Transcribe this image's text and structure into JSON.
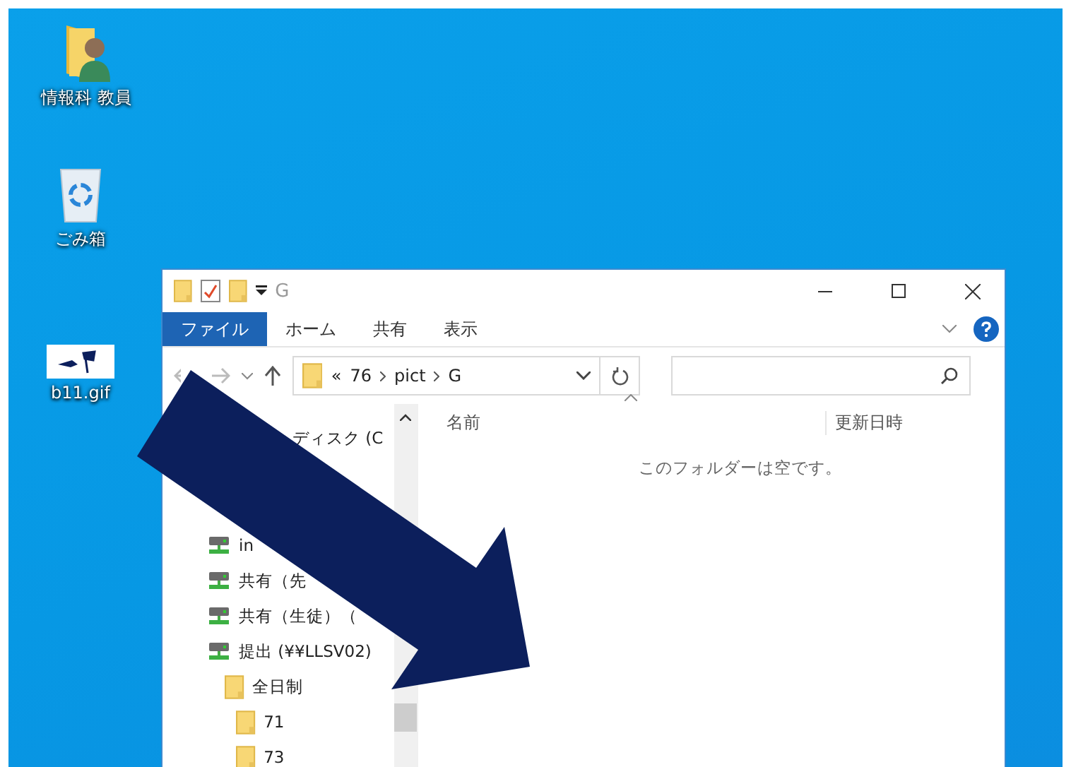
{
  "desktop_icons": [
    {
      "label": "情報科 教員",
      "kind": "user-folder"
    },
    {
      "label": "ごみ箱",
      "kind": "recycle-bin"
    },
    {
      "label": "b11.gif",
      "kind": "image-file"
    }
  ],
  "window": {
    "title": "G",
    "ribbon_tabs": [
      {
        "label": "ファイル",
        "selected": true
      },
      {
        "label": "ホーム",
        "selected": false
      },
      {
        "label": "共有",
        "selected": false
      },
      {
        "label": "表示",
        "selected": false
      }
    ],
    "address": {
      "overflow": "«",
      "crumbs": [
        "76",
        "pict",
        "G"
      ]
    },
    "nav_pane": {
      "items": [
        {
          "label": "ディスク (C",
          "kind": "drive"
        },
        {
          "label": "in",
          "kind": "network-drive"
        },
        {
          "label": "共有（先",
          "kind": "network-drive"
        },
        {
          "label": "共有（生徒）（",
          "kind": "network-drive"
        },
        {
          "label": "提出 (¥¥LLSV02)",
          "kind": "network-drive",
          "children": [
            {
              "label": "全日制",
              "kind": "folder",
              "children": [
                {
                  "label": "71",
                  "kind": "folder"
                },
                {
                  "label": "73",
                  "kind": "folder"
                }
              ]
            }
          ]
        }
      ]
    },
    "columns": [
      "名前",
      "更新日時"
    ],
    "empty_message": "このフォルダーは空です。"
  }
}
